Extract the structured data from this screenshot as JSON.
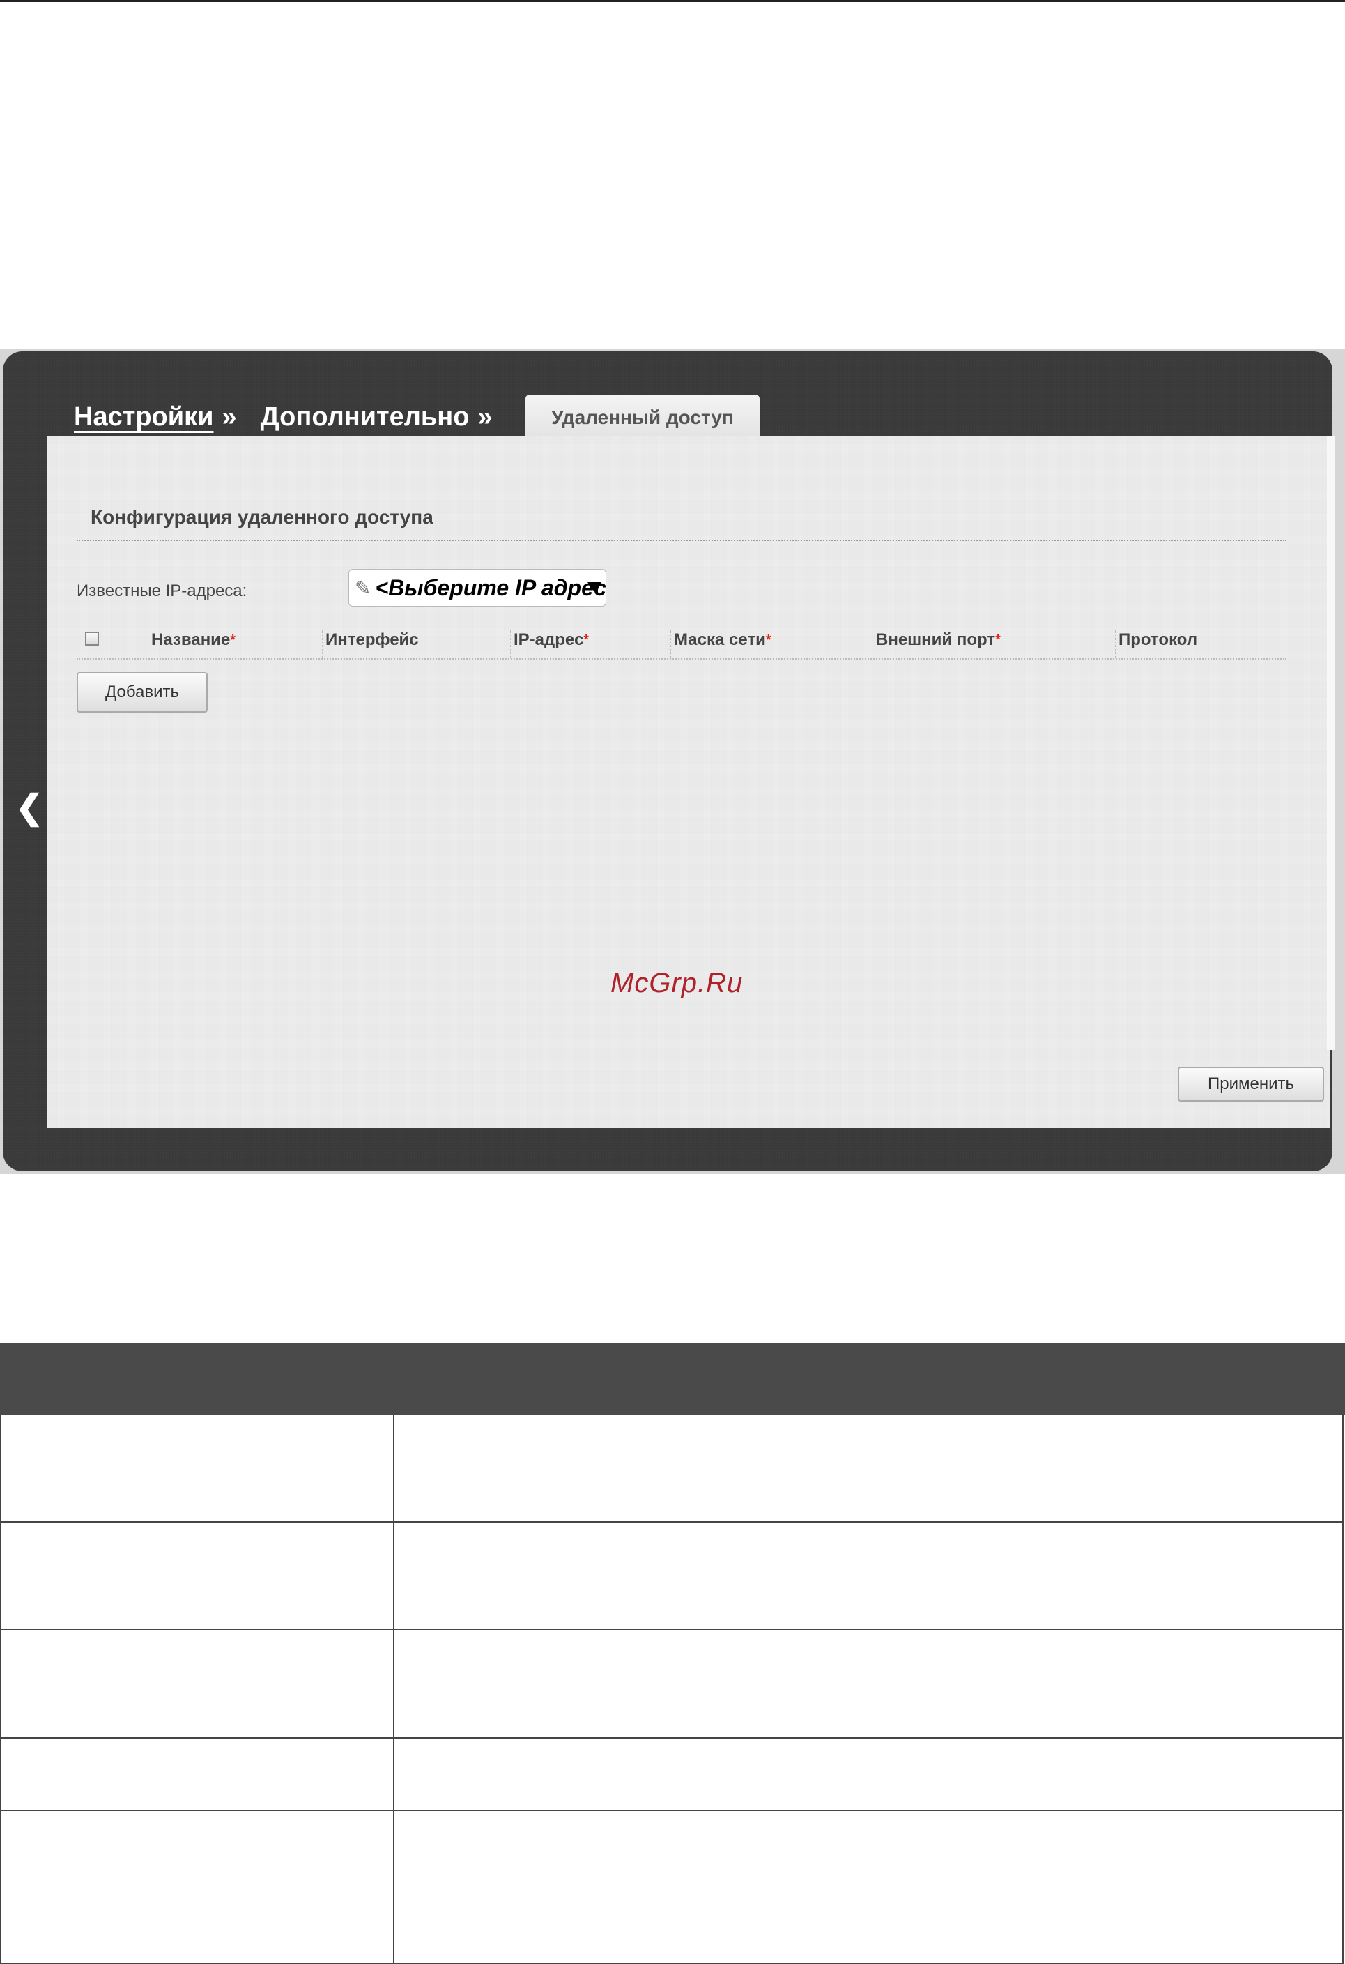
{
  "breadcrumb": {
    "items": [
      "Настройки",
      "Дополнительно"
    ],
    "separator": "»"
  },
  "active_tab": "Удаленный доступ",
  "section_title": "Конфигурация удаленного доступа",
  "known_ips": {
    "label": "Известные IP-адреса:",
    "select_value": "<Выберите IP адрес>"
  },
  "table": {
    "columns": [
      {
        "label": "Название",
        "required": true
      },
      {
        "label": "Интерфейс",
        "required": false
      },
      {
        "label": "IP-адрес",
        "required": true
      },
      {
        "label": "Маска сети",
        "required": true
      },
      {
        "label": "Внешний порт",
        "required": true
      },
      {
        "label": "Протокол",
        "required": false
      }
    ],
    "required_mark": "*"
  },
  "buttons": {
    "add": "Добавить",
    "apply": "Применить"
  },
  "watermark": "McGrp.Ru",
  "colors": {
    "frame_dark": "#3a3a3a",
    "panel": "#ececec",
    "required": "#dd1111",
    "watermark": "#b0222a",
    "table_head": "#4a4a4a"
  },
  "icons": [
    "back-arrow-icon",
    "pencil-icon",
    "dropdown-icon",
    "checkbox-icon"
  ]
}
